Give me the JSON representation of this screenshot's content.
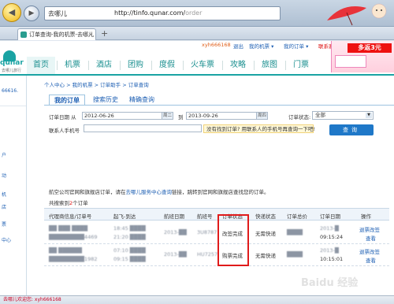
{
  "browser": {
    "address_prefix": "去哪儿",
    "url": "http://tinfo.qunar.com/",
    "url_tail": "order",
    "tab_label": "订单查询-我的机票-去哪儿",
    "tab_close": "×",
    "new_tab": "+",
    "back_glyph": "◀",
    "forward_glyph": "▶"
  },
  "toolbar": {
    "user": "xyh666168",
    "logout": "退出",
    "my_tickets": "我的机票 ▾",
    "my_orders": "我的订单 ▾",
    "support": "联系客服",
    "favorite": "收藏"
  },
  "logo": {
    "word": "qunar",
    "sub": "去哪儿旅行"
  },
  "ad": {
    "badge": "多返3元"
  },
  "main_nav": [
    "首页",
    "机票",
    "酒店",
    "团购",
    "度假",
    "火车票",
    "攻略",
    "旅图",
    "门票"
  ],
  "left_panel": [
    "66616.",
    "户",
    "动",
    "机",
    "店",
    "票",
    "中心"
  ],
  "breadcrumb": "个人中心 > 我的机票 > 订单助手 > 订单查询",
  "subtabs": [
    "我的订单",
    "搜索历史",
    "精确查询"
  ],
  "form": {
    "order_date_label": "订单日期 从",
    "from_date": "2012-06-26",
    "from_weekday": "周二",
    "to_label": "到",
    "to_date": "2013-09-26",
    "to_weekday": "周四",
    "status_label": "订单状态:",
    "status_value": "全部",
    "contact_label": "联系人手机号",
    "tip": "没有找到订单? 用联系人的手机号再查询一下吧!",
    "query_button": "查询"
  },
  "notice": {
    "text_before": "航空公司官网和旗舰店订单，请在",
    "link": "去哪儿服务中心查询",
    "text_after": "链接，跳转到官网和旗舰店查找您的订单。"
  },
  "count": {
    "prefix": "共搜索到",
    "number": "2",
    "suffix": "个订单"
  },
  "table": {
    "headers": [
      "代理商信息/订单号",
      "起飞-到达",
      "航班日期",
      "航班号",
      "订单状态",
      "快递状态",
      "订单总价",
      "订单日期",
      "操作"
    ],
    "rows": [
      {
        "agent": "██ ███ ████",
        "order_no": "█████████4469",
        "depart": "18:45 ████",
        "arrive": "21:20 ████",
        "flight_date": "2013-██",
        "flight_no": "3U8787",
        "status": "改签完成",
        "express": "无需快递",
        "total": "████",
        "order_date": "2013-█",
        "order_time": "09:15:24",
        "action_1": "退票改签",
        "action_2": "查看"
      },
      {
        "agent": "██ ██████",
        "order_no": "█████████1982",
        "depart": "07:10 ████",
        "arrive": "09:15 ████",
        "flight_date": "2013-██",
        "flight_no": "HU7257",
        "status": "购票完成",
        "express": "无需快递",
        "total": "████",
        "order_date": "2013-█",
        "order_time": "10:15:01",
        "action_1": "退票改签",
        "action_2": "查看"
      }
    ]
  },
  "status_bar": "去哪儿欢迎您: xyh666168",
  "watermark": "Baidu 经验"
}
